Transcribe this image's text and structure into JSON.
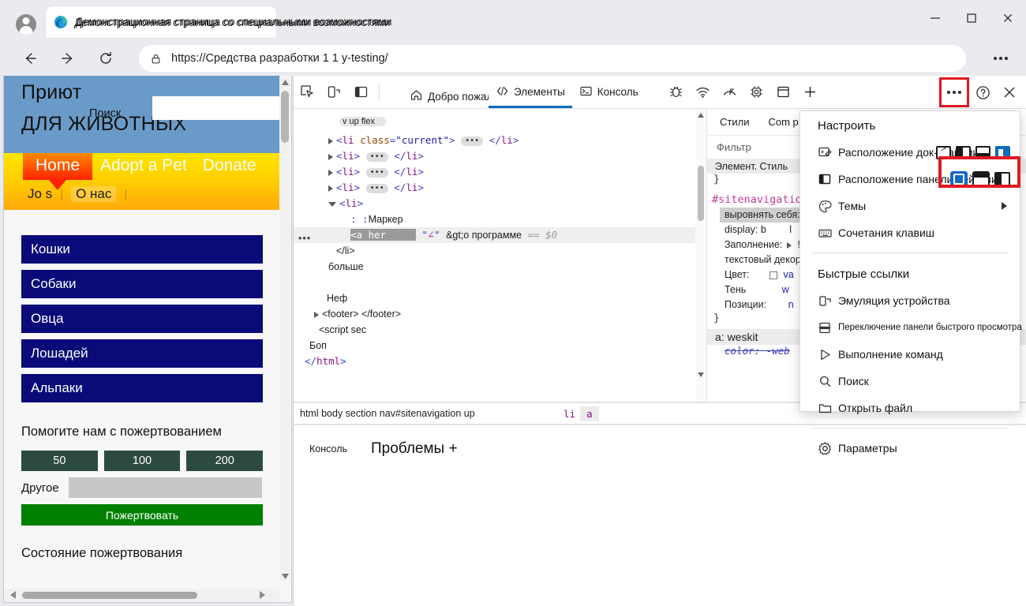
{
  "browser": {
    "tab": {
      "title": "Демонстрационная страница со специальными возможностями",
      "favicon": "edge-logo-icon"
    },
    "window_controls": {
      "minimize": "minimize-icon",
      "maximize": "maximize-icon",
      "close": "close-icon"
    },
    "nav": {
      "back": "back-arrow-icon",
      "forward": "forward-arrow-icon",
      "reload": "reload-icon",
      "more": "more-options-icon"
    },
    "omnibox": {
      "url": "https://Средства разработки 1 1 y-testing/",
      "lock": "lock-icon"
    },
    "profile": "account-avatar-icon"
  },
  "webpage": {
    "title_line1": "Приют",
    "title_line2": "ДЛЯ ЖИВОТНЫХ",
    "search_label": "Поиск",
    "search_value": "",
    "nav_primary": [
      "Home",
      "Adopt a Pet",
      "Donate"
    ],
    "nav_secondary": [
      "Jo s",
      "О нас"
    ],
    "categories": [
      "Кошки",
      "Собаки",
      "Овца",
      "Лошадей",
      "Альпаки"
    ],
    "donate": {
      "heading": "Помогите нам с пожертвованием",
      "amounts": [
        "50",
        "100",
        "200"
      ],
      "other_label": "Другое",
      "other_value": "",
      "submit": "Пожертвовать"
    },
    "status_heading": "Состояние пожертвования"
  },
  "devtools": {
    "toolbar_left_icons": [
      "inspect-element-icon",
      "device-emulation-icon",
      "sidebar-toggle-icon"
    ],
    "tabs": [
      {
        "label": "Добро пожаловать",
        "icon": "home-icon",
        "active": false
      },
      {
        "label": "Элементы",
        "icon": "code-brackets-icon",
        "active": true
      },
      {
        "label": "Консоль",
        "icon": "console-terminal-icon",
        "active": false
      }
    ],
    "toolbar_right_icons": [
      "bug-icon",
      "network-wifi-icon",
      "performance-gauge-icon",
      "settings-chip-icon",
      "layers-icon",
      "add-tab-icon"
    ],
    "customize_button": "more-options-icon",
    "help_button": "help-question-icon",
    "close_button": "close-icon",
    "dom": {
      "badge": "v up flex",
      "rows": [
        {
          "indent": 34,
          "tri": "closed",
          "html": "<span class=\"punct\">&lt;</span><span class=\"tag\">li</span> <span class=\"attr\">class</span><span class=\"punct\">=</span><span class=\"val\">\"current\"</span><span class=\"punct\">&gt;</span> <span class=\"pill\">•••</span> <span class=\"punct\">&lt;/</span><span class=\"tag\">li</span><span class=\"punct\">&gt;</span>"
        },
        {
          "indent": 34,
          "tri": "closed",
          "html": "<span class=\"punct\">&lt;</span><span class=\"tag\">li</span><span class=\"punct\">&gt;</span> <span class=\"pill\">•••</span> <span class=\"punct\">&lt;/</span><span class=\"tag\">li</span><span class=\"punct\">&gt;</span>"
        },
        {
          "indent": 34,
          "tri": "closed",
          "html": "<span class=\"punct\">&lt;</span><span class=\"tag\">li</span><span class=\"punct\">&gt;</span> <span class=\"pill\">•••</span> <span class=\"punct\">&lt;/</span><span class=\"tag\">li</span><span class=\"punct\">&gt;</span>"
        },
        {
          "indent": 34,
          "tri": "closed",
          "html": "<span class=\"punct\">&lt;</span><span class=\"tag\">li</span><span class=\"punct\">&gt;</span> <span class=\"pill\">•••</span> <span class=\"punct\">&lt;/</span><span class=\"tag\">li</span><span class=\"punct\">&gt;</span>"
        },
        {
          "indent": 34,
          "tri": "open",
          "html": "<span class=\"punct\">&lt;</span><span class=\"tag\">li</span><span class=\"punct\">&gt;</span>"
        },
        {
          "indent": 62,
          "tri": "none",
          "html": "<span class=\"punct\">: :</span><span class=\"txt\">Маркер</span>"
        },
        {
          "indent": 62,
          "tri": "none",
          "selected": true,
          "html": "<span class=\"sel-tok\">&lt;a her&nbsp;&nbsp;&nbsp;&nbsp;&nbsp;</span> <span class=\"punct\">\"</span><span class=\"selector\" style=\"padding:0\">∠</span><span class=\"punct\">\"</span> <span class=\"txt\">&amp;gt;о программе</span> <span class=\"eq\">==</span> <span class=\"dollar\">$0</span>"
        },
        {
          "indent": 44,
          "tri": "none",
          "html": "<span class=\"txt\">&lt;/li&gt;</span>"
        },
        {
          "indent": 34,
          "tri": "none",
          "html": "<span class=\"txt\">больше</span>"
        },
        {
          "indent": 34,
          "tri": "none",
          "html": ""
        },
        {
          "indent": 32,
          "tri": "none",
          "html": "<span class=\"txt\">Неф</span>"
        },
        {
          "indent": 16,
          "tri": "closed",
          "html": "<span class=\"txt\">&lt;footer&gt; &lt;/footer&gt;</span>"
        },
        {
          "indent": 22,
          "tri": "none",
          "html": "<span class=\"txt\">&lt;script sec</span>"
        },
        {
          "indent": 10,
          "tri": "none",
          "html": "<span class=\"txt\">Боп</span>"
        },
        {
          "indent": 4,
          "tri": "none",
          "html": "<span class=\"punct\">&lt;/</span><span class=\"tag\">html</span><span class=\"punct\">&gt;</span>"
        }
      ],
      "overlay_texts": []
    },
    "styles": {
      "tabs": [
        "Стили",
        "Com p"
      ],
      "filter_placeholder": "Фильтр",
      "rules": [
        {
          "head": "Элемент. Стиль",
          "close": "}"
        },
        {
          "selector": "#sitenavigatio",
          "declarations": [
            {
              "name": "выровнять себя:",
              "value": "",
              "highlight": true
            },
            {
              "name": "display: b",
              "value": "l"
            },
            {
              "name": "Заполнение:",
              "value": "!"
            },
            {
              "name": "текстовый декор",
              "value": ""
            },
            {
              "name": "Цвет:",
              "value": "va",
              "checkbox": true
            },
            {
              "name": "Тень",
              "value": "w"
            },
            {
              "name": "Позиции:",
              "value": "n"
            }
          ],
          "close": "}"
        }
      ],
      "last_rule_head": "a: weskit",
      "last_rule_decl": "color: -web"
    },
    "breadcrumb": {
      "path": "html body section nav#sitenavigation up",
      "tail": [
        "li",
        "a"
      ]
    },
    "drawer": {
      "tabs": [
        "Консоль",
        "Проблемы +"
      ]
    }
  },
  "menu": {
    "section1_title": "Настроить",
    "items1": [
      {
        "label": "Расположение док-станции",
        "icon": "dock-location-icon",
        "trailing": "dock-position-choices"
      },
      {
        "label": "Расположение панели действий",
        "icon": "action-bar-icon",
        "trailing": "action-bar-choices",
        "highlighted": true
      },
      {
        "label": "Темы",
        "icon": "palette-icon",
        "submenu": true
      },
      {
        "label": "Сочетания клавиш",
        "icon": "keyboard-icon"
      }
    ],
    "section2_title": "Быстрые ссылки",
    "items2": [
      {
        "label": "Эмуляция устройства",
        "icon": "device-emulation-icon"
      },
      {
        "label": "Переключение панели быстрого просмотра",
        "icon": "quick-view-icon",
        "small": true
      },
      {
        "label": "Выполнение команд",
        "icon": "run-command-icon"
      },
      {
        "label": "Поиск",
        "icon": "search-icon"
      },
      {
        "label": "Открыть файл",
        "icon": "folder-open-icon"
      }
    ],
    "items3": [
      {
        "label": "Параметры",
        "icon": "gear-icon"
      }
    ]
  },
  "colors": {
    "accent_blue": "#0f6cbd",
    "highlight_red": "#e01b24",
    "site_header_blue": "#6a9bc8",
    "nav_yellow": "#ffd000",
    "category_navy": "#0a0a78",
    "donate_green": "#008000"
  }
}
